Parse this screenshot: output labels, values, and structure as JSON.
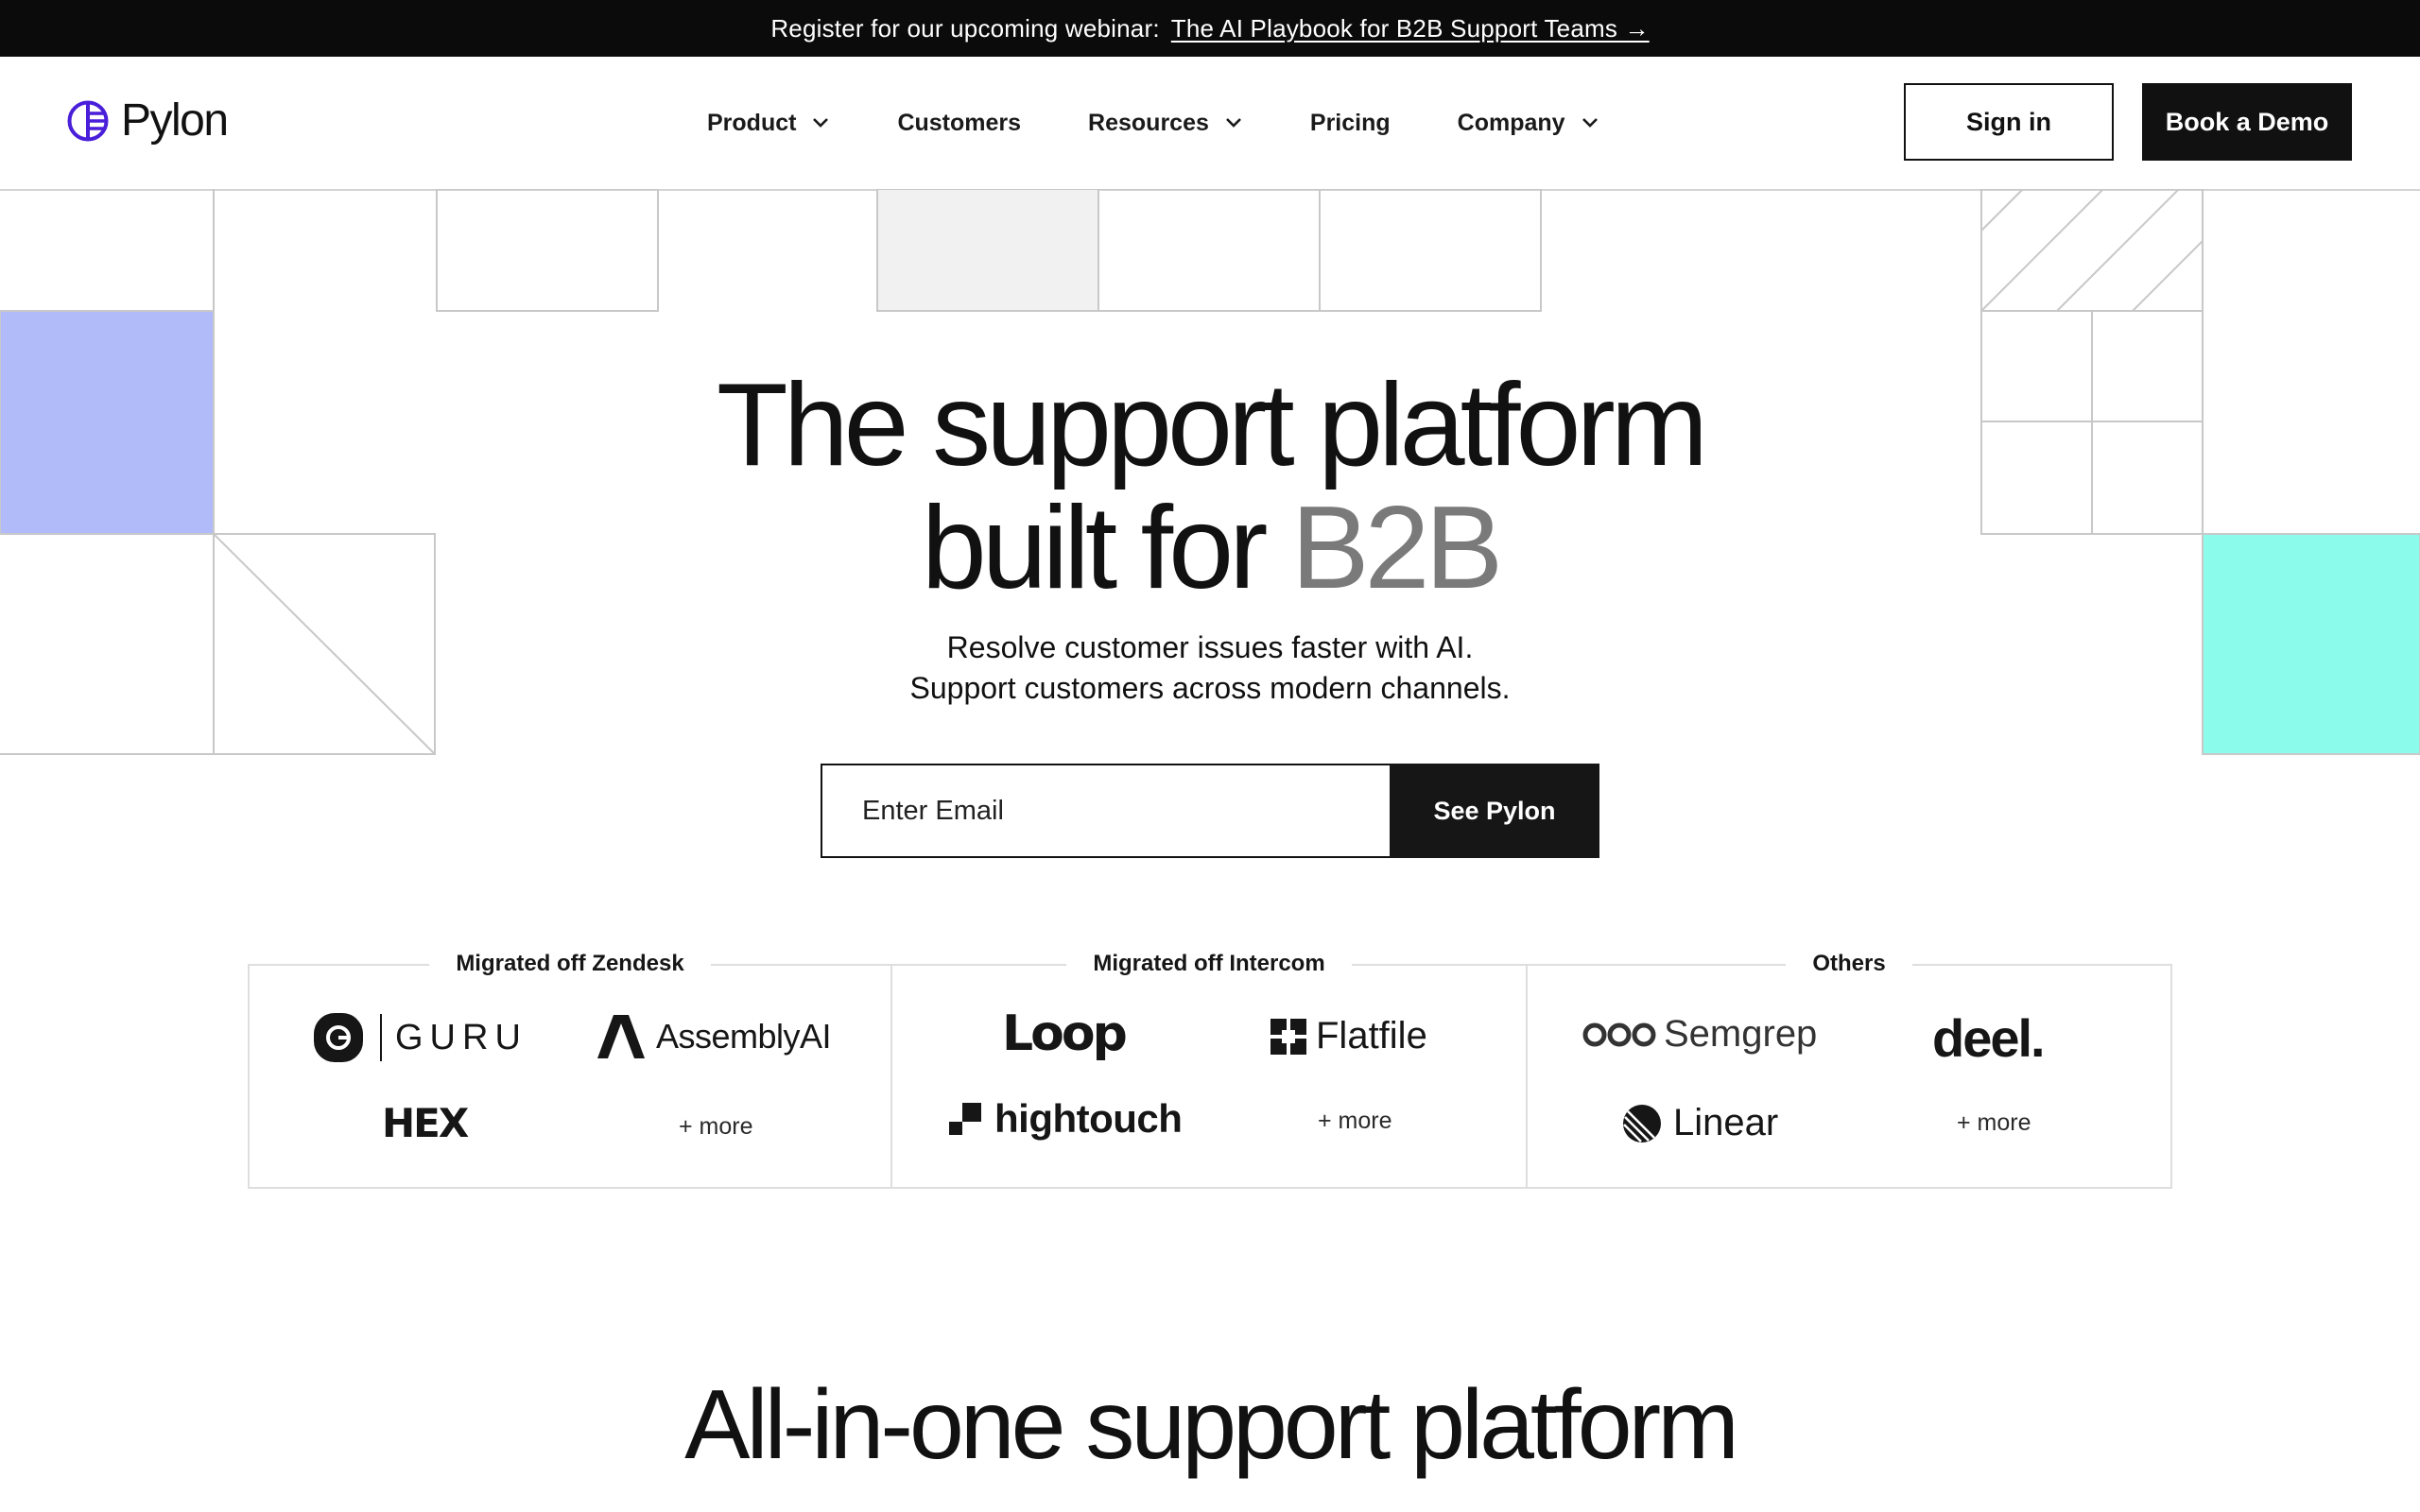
{
  "announcement": {
    "text": "Register for our upcoming webinar:",
    "link": "The AI Playbook for B2B Support Teams →"
  },
  "header": {
    "logo": "Pylon",
    "nav": [
      {
        "label": "Product",
        "has_dropdown": true
      },
      {
        "label": "Customers",
        "has_dropdown": false
      },
      {
        "label": "Resources",
        "has_dropdown": true
      },
      {
        "label": "Pricing",
        "has_dropdown": false
      },
      {
        "label": "Company",
        "has_dropdown": true
      }
    ],
    "sign_in": "Sign in",
    "book_demo": "Book a Demo"
  },
  "hero": {
    "title_line1": "The support platform",
    "title_line2_prefix": "built for ",
    "title_line2_accent": "B2B",
    "subtitle_line1": "Resolve customer issues faster with AI.",
    "subtitle_line2": "Support customers across modern channels.",
    "email_placeholder": "Enter Email",
    "cta": "See Pylon"
  },
  "migrations": [
    {
      "label": "Migrated off Zendesk",
      "brands": [
        "GURU",
        "AssemblyAI",
        "HEX"
      ],
      "more": "+ more"
    },
    {
      "label": "Migrated off Intercom",
      "brands": [
        "Loop",
        "Flatfile",
        "hightouch"
      ],
      "more": "+ more"
    },
    {
      "label": "Others",
      "brands": [
        "Semgrep",
        "deel.",
        "Linear"
      ],
      "more": "+ more"
    }
  ],
  "section": {
    "title": "All-in-one support platform"
  },
  "colors": {
    "brand": "#4a1fd9",
    "periwinkle": "#b1bbf9",
    "mint": "#8bfcec",
    "light_gray": "#f1f1f1",
    "dark": "#111111"
  },
  "icons": [
    "pylon-logo-icon",
    "chevron-down-icon",
    "guru-logo-icon",
    "assemblyai-logo-icon",
    "flatfile-logo-icon",
    "hightouch-logo-icon",
    "semgrep-logo-icon",
    "linear-logo-icon"
  ]
}
